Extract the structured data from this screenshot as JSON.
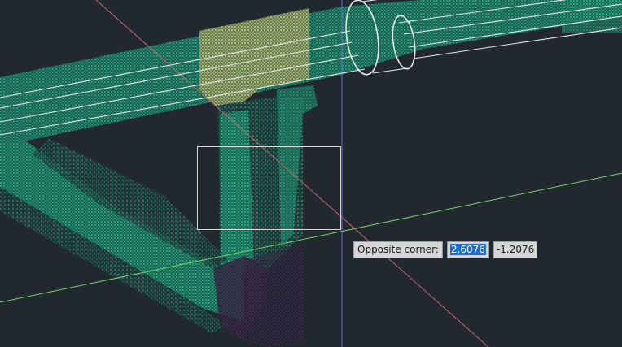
{
  "dynamic_input": {
    "prompt_label": "Opposite corner:",
    "x_value": "2.6076",
    "y_value": "-1.2076"
  },
  "colors": {
    "background": "#212830",
    "point_cloud_green": "#2ed59a",
    "point_cloud_yellow": "#d9e4a8",
    "point_cloud_purple": "#5a1a6a",
    "pipe_wireframe": "#e8e8e8",
    "axis_x_red": "#c46a6a",
    "axis_y_green": "#7ccf6a",
    "cursor_blue": "#6a6ae0",
    "selection_window": "#d8d8d8",
    "selection_highlight": "#1a6cd6"
  },
  "scene": {
    "crosshair_cursor": "crosshair-cursor-icon",
    "selection_mode": "window-selection"
  }
}
